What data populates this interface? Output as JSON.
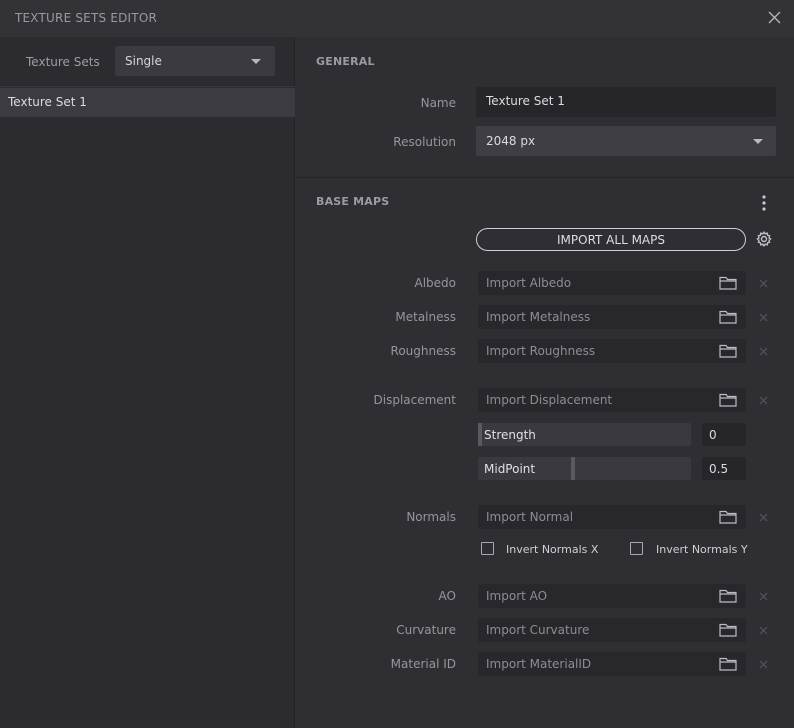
{
  "window": {
    "title": "TEXTURE SETS EDITOR"
  },
  "left": {
    "texture_sets_label": "Texture Sets",
    "mode_select": "Single",
    "items": [
      "Texture Set 1"
    ]
  },
  "general": {
    "title": "GENERAL",
    "name_label": "Name",
    "name_value": "Texture Set 1",
    "resolution_label": "Resolution",
    "resolution_value": "2048 px"
  },
  "base_maps": {
    "title": "BASE MAPS",
    "import_all_label": "IMPORT ALL MAPS",
    "albedo": {
      "label": "Albedo",
      "placeholder": "Import Albedo"
    },
    "metalness": {
      "label": "Metalness",
      "placeholder": "Import Metalness"
    },
    "roughness": {
      "label": "Roughness",
      "placeholder": "Import Roughness"
    },
    "displacement": {
      "label": "Displacement",
      "placeholder": "Import Displacement",
      "strength_label": "Strength",
      "strength_value": "0",
      "midpoint_label": "MidPoint",
      "midpoint_value": "0.5"
    },
    "normals": {
      "label": "Normals",
      "placeholder": "Import Normal",
      "invert_x_label": "Invert Normals X",
      "invert_y_label": "Invert Normals Y"
    },
    "ao": {
      "label": "AO",
      "placeholder": "Import AO"
    },
    "curvature": {
      "label": "Curvature",
      "placeholder": "Import Curvature"
    },
    "material_id": {
      "label": "Material ID",
      "placeholder": "Import MaterialID"
    }
  }
}
